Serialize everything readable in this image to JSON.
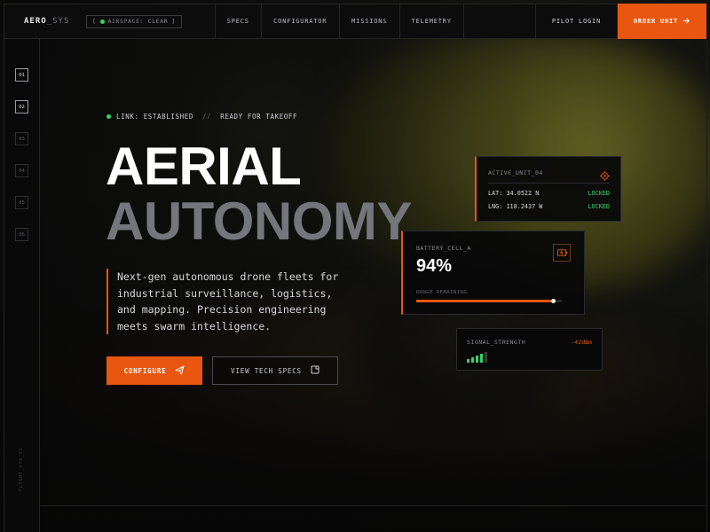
{
  "brand": {
    "name": "AERO",
    "suffix": "_SYS"
  },
  "status_chip": {
    "prefix": "[",
    "text": "AIRSPACE: CLEAR",
    "suffix": "]"
  },
  "nav": [
    "SPECS",
    "CONFIGURATOR",
    "MISSIONS",
    "TELEMETRY"
  ],
  "login_label": "PILOT LOGIN",
  "order_label": "ORDER UNIT",
  "rail": {
    "items": [
      "01",
      "02",
      "03",
      "04",
      "05",
      "06"
    ],
    "active_indices": [
      0,
      1
    ],
    "vertical_text": "FLIGHT_SYS_V2"
  },
  "hero": {
    "status": "LINK: ESTABLISHED",
    "separator": "//",
    "status2": "READY FOR TAKEOFF",
    "title_line1": "AERIAL",
    "title_line2": "AUTONOMY",
    "description": "Next-gen autonomous drone fleets for industrial surveillance, logistics, and mapping. Precision engineering meets swarm intelligence.",
    "primary_cta": "CONFIGURE",
    "secondary_cta": "VIEW TECH SPECS"
  },
  "unit_card": {
    "label": "ACTIVE_UNIT_04",
    "lat": "LAT: 34.0522 N",
    "lat_status": "LOCKED",
    "lng": "LNG: 118.2437 W",
    "lng_status": "LOCKED"
  },
  "battery_card": {
    "label": "BATTERY_CELL_A",
    "value": "94%",
    "range_label": "RANGE REMAINING",
    "range_fraction": 0.94
  },
  "signal_card": {
    "label": "SIGNAL_STRENGTH",
    "value": "-42dBm",
    "bars_active": 4,
    "bars_total": 5
  },
  "colors": {
    "accent": "#e8560f",
    "ok": "#36d36a",
    "background": "#0a0a0b",
    "muted_title": "#75757c"
  },
  "icons": {
    "configure": "send-arrow-icon",
    "specs": "document-icon",
    "order": "arrow-right-icon",
    "unit": "crosshair-icon",
    "battery": "battery-icon"
  }
}
